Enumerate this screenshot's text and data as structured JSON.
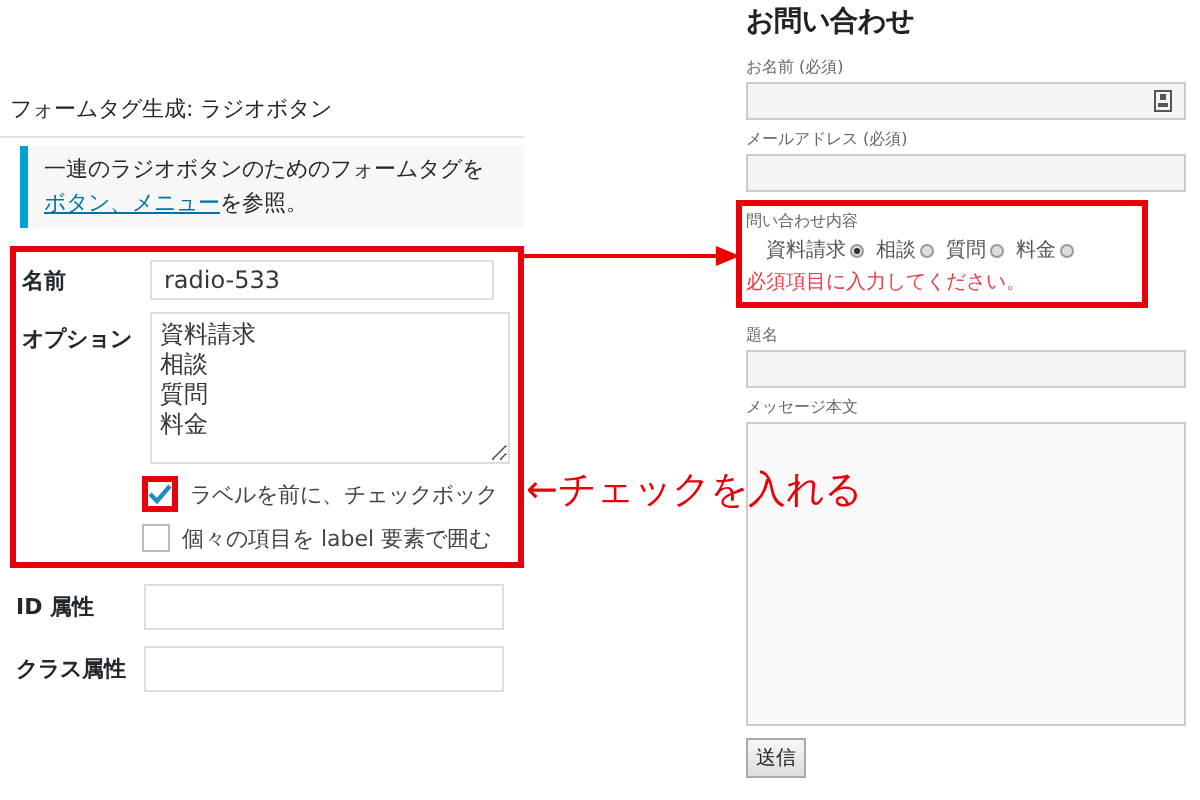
{
  "generator": {
    "title": "フォームタグ生成: ラジオボタン",
    "notice": {
      "text": "一連のラジオボタンのためのフォームタグを",
      "link": "ボタン、メニュー",
      "suffix": "を参照。"
    },
    "name_field": {
      "label": "名前",
      "value": "radio-533"
    },
    "options_field": {
      "label": "オプション",
      "lines": [
        "資料請求",
        "相談",
        "質問",
        "料金"
      ]
    },
    "checkboxes": [
      {
        "label": "ラベルを前に、チェックボック",
        "checked": true,
        "highlighted": true
      },
      {
        "label": "個々の項目を label 要素で囲む",
        "checked": false,
        "highlighted": false
      }
    ],
    "id_field": {
      "label": "ID 属性"
    },
    "class_field": {
      "label": "クラス属性"
    }
  },
  "annotation": "←チェックを入れる",
  "preview": {
    "title": "お問い合わせ",
    "fields": [
      {
        "kind": "text",
        "label": "お名前 (必須)",
        "autofill_icon": true
      },
      {
        "kind": "text",
        "label": "メールアドレス (必須)",
        "autofill_icon": false
      },
      {
        "kind": "radio",
        "label": "問い合わせ内容",
        "options": [
          {
            "label": "資料請求",
            "selected": true
          },
          {
            "label": "相談",
            "selected": false
          },
          {
            "label": "質問",
            "selected": false
          },
          {
            "label": "料金",
            "selected": false
          }
        ],
        "error": "必須項目に入力してください。"
      },
      {
        "kind": "text",
        "label": "題名",
        "autofill_icon": false
      },
      {
        "kind": "textarea",
        "label": "メッセージ本文"
      }
    ],
    "submit": "送信"
  }
}
